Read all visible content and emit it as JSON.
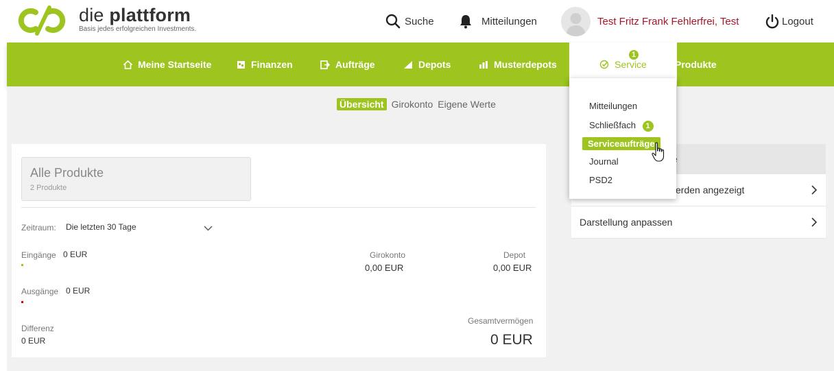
{
  "brand": {
    "name_light": "die ",
    "name_bold": "plattform",
    "tagline": "Basis jedes erfolgreichen Investments.",
    "color": "#9dc41f"
  },
  "header": {
    "search_label": "Suche",
    "notifications_label": "Mitteilungen",
    "user_name": "Test Fritz Frank Fehlerfrei, Test",
    "logout_label": "Logout"
  },
  "nav": {
    "items": [
      {
        "label": "Meine Startseite",
        "icon": "home-icon"
      },
      {
        "label": "Finanzen",
        "icon": "finance-icon"
      },
      {
        "label": "Aufträge",
        "icon": "orders-icon"
      },
      {
        "label": "Depots",
        "icon": "depots-icon"
      },
      {
        "label": "Musterdepots",
        "icon": "chart-icon"
      },
      {
        "label": "Service",
        "icon": "check-icon",
        "badge": "1"
      },
      {
        "label": "Produkte",
        "icon": "grid-icon"
      }
    ]
  },
  "service_menu": {
    "items": [
      {
        "label": "Mitteilungen"
      },
      {
        "label": "Schließfach",
        "badge": "1"
      },
      {
        "label": "Serviceaufträge"
      },
      {
        "label": "Journal"
      },
      {
        "label": "PSD2"
      }
    ]
  },
  "subtabs": [
    "Übersicht",
    "Girokonto",
    "Eigene Werte"
  ],
  "overview": {
    "product_title": "Alle Produkte",
    "product_count": "2 Produkte",
    "period_label": "Zeitraum:",
    "period_value": "Die letzten 30 Tage",
    "income_label": "Eingänge",
    "income_value": "0 EUR",
    "expense_label": "Ausgänge",
    "expense_value": "0 EUR",
    "diff_label": "Differenz",
    "diff_value": "0 EUR",
    "giro_label": "Girokonto",
    "giro_value": "0,00 EUR",
    "depot_label": "Depot",
    "depot_value": "0,00 EUR",
    "total_label": "Gesamtvermögen",
    "total_value": "0 EUR"
  },
  "side_panel": {
    "head_fragment": "ite",
    "row1_fragment": "erden angezeigt",
    "row2": "Darstellung anpassen"
  }
}
